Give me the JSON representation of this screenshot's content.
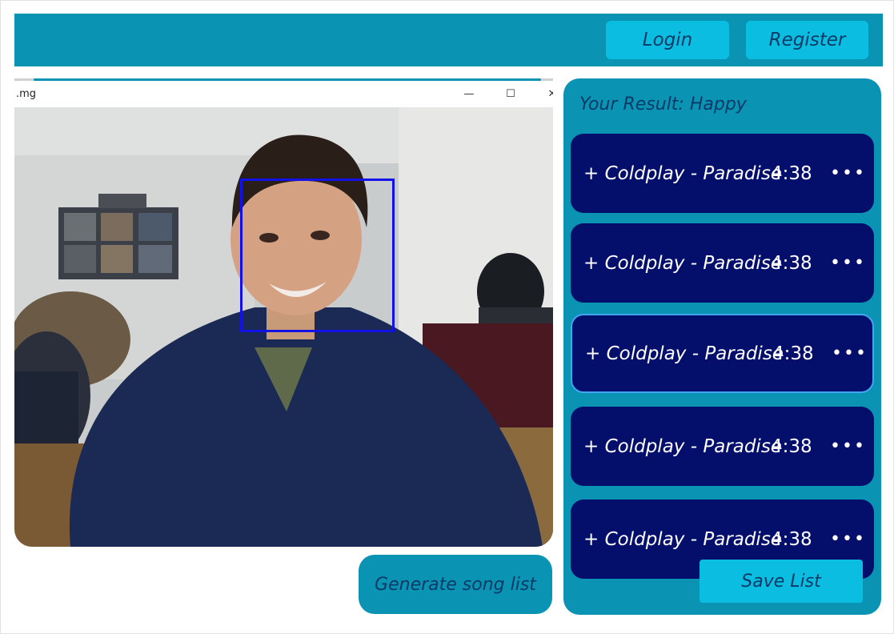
{
  "header": {
    "login_label": "Login",
    "register_label": "Register"
  },
  "camera_window": {
    "title": ".mg",
    "minimize_glyph": "—",
    "maximize_glyph": "☐",
    "close_glyph": "✕"
  },
  "actions": {
    "generate_label": "Generate song list"
  },
  "results": {
    "title": "Your Result: Happy",
    "songs": [
      {
        "label": "+ Coldplay - Paradise",
        "duration": "4:38",
        "more": "•••"
      },
      {
        "label": "+ Coldplay - Paradise",
        "duration": "4:38",
        "more": "•••"
      },
      {
        "label": "+ Coldplay - Paradise",
        "duration": "4:38",
        "more": "•••"
      },
      {
        "label": "+ Coldplay - Paradise",
        "duration": "4:38",
        "more": "•••"
      },
      {
        "label": "+ Coldplay - Paradise",
        "duration": "4:38",
        "more": "•••"
      }
    ],
    "save_label": "Save List"
  },
  "colors": {
    "header_bg": "#0a93b3",
    "button_light": "#0bbde0",
    "song_card_bg": "#040f6c",
    "face_box": "#1212e8"
  }
}
